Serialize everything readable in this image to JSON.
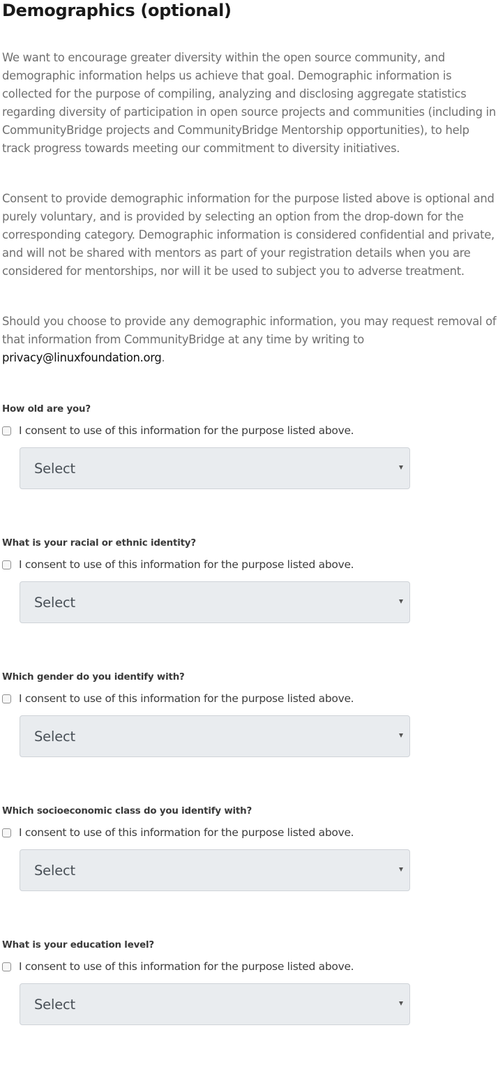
{
  "title": "Demographics (optional)",
  "intro": {
    "paragraph1": "We want to encourage greater diversity within the open source community, and demographic information helps us achieve that goal. Demographic information is collected for the purpose of compiling, analyzing and disclosing aggregate statistics regarding diversity of participation in open source projects and communities (including in CommunityBridge projects and CommunityBridge Mentorship opportunities), to help track progress towards meeting our commitment to diversity initiatives.",
    "paragraph2": "Consent to provide demographic information for the purpose listed above is optional and purely voluntary, and is provided by selecting an option from the drop-down for the corresponding category. Demographic information is considered confidential and private, and will not be shared with mentors as part of your registration details when you are considered for mentorships, nor will it be used to subject you to adverse treatment.",
    "paragraph3_text": "Should you choose to provide any demographic information, you may request removal of that information from CommunityBridge at any time by writing to ",
    "paragraph3_email": "privacy@linuxfoundation.org",
    "paragraph3_end": "."
  },
  "questions": [
    {
      "label": "How old are you?",
      "consent_label": "I consent to use of this information for the purpose listed above.",
      "consent_checked": false,
      "select_value": "Select"
    },
    {
      "label": "What is your racial or ethnic identity?",
      "consent_label": "I consent to use of this information for the purpose listed above.",
      "consent_checked": false,
      "select_value": "Select"
    },
    {
      "label": "Which gender do you identify with?",
      "consent_label": "I consent to use of this information for the purpose listed above.",
      "consent_checked": false,
      "select_value": "Select"
    },
    {
      "label": "Which socioeconomic class do you identify with?",
      "consent_label": "I consent to use of this information for the purpose listed above.",
      "consent_checked": false,
      "select_value": "Select"
    },
    {
      "label": "What is your education level?",
      "consent_label": "I consent to use of this information for the purpose listed above.",
      "consent_checked": false,
      "select_value": "Select"
    }
  ],
  "colors": {
    "title": "#1a1a1a",
    "body_text": "#707070",
    "link": "#111111",
    "question_label": "#3a3a3a",
    "select_background": "#e9ecef",
    "select_border": "#cfd3d8"
  },
  "icons": {
    "checkbox": "checkbox-unchecked-icon",
    "dropdown": "caret-down-icon"
  }
}
